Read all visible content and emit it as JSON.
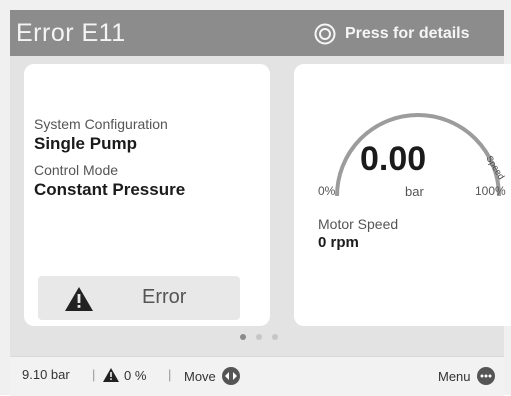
{
  "header": {
    "title": "Error E11",
    "details_label": "Press for details"
  },
  "left_card": {
    "config_label": "System Configuration",
    "config_value": "Single Pump",
    "mode_label": "Control Mode",
    "mode_value": "Constant Pressure",
    "status_label": "Error"
  },
  "right_card": {
    "gauge_value": "0.00",
    "gauge_unit": "bar",
    "gauge_min": "0%",
    "gauge_max": "100%",
    "gauge_arc_label": "Speed",
    "motor_speed_label": "Motor Speed",
    "motor_speed_value": "0 rpm"
  },
  "pager": {
    "current": 1,
    "total": 3
  },
  "footer": {
    "pressure": "9.10 bar",
    "warning_percent": "0 %",
    "move_label": "Move",
    "menu_label": "Menu"
  },
  "colors": {
    "header_bg": "#8c8c8c",
    "panel_bg": "#e3e3e3",
    "card_bg": "#ffffff",
    "text_dark": "#1b1b1b",
    "text_muted": "#555555"
  },
  "icons": {
    "details": "target-circle-icon",
    "status": "warning-triangle-icon",
    "footer_warning": "warning-triangle-icon",
    "move": "left-right-arrows-icon",
    "menu": "ellipsis-icon"
  }
}
